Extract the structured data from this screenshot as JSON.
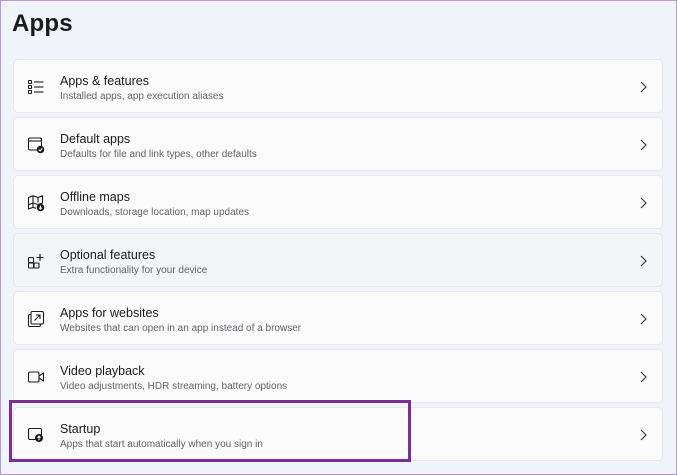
{
  "page": {
    "title": "Apps"
  },
  "items": [
    {
      "title": "Apps & features",
      "desc": "Installed apps, app execution aliases",
      "icon": "apps-list-icon"
    },
    {
      "title": "Default apps",
      "desc": "Defaults for file and link types, other defaults",
      "icon": "default-apps-icon"
    },
    {
      "title": "Offline maps",
      "desc": "Downloads, storage location, map updates",
      "icon": "map-icon"
    },
    {
      "title": "Optional features",
      "desc": "Extra functionality for your device",
      "icon": "optional-features-icon"
    },
    {
      "title": "Apps for websites",
      "desc": "Websites that can open in an app instead of a browser",
      "icon": "open-link-icon"
    },
    {
      "title": "Video playback",
      "desc": "Video adjustments, HDR streaming, battery options",
      "icon": "video-icon"
    },
    {
      "title": "Startup",
      "desc": "Apps that start automatically when you sign in",
      "icon": "startup-icon"
    }
  ],
  "colors": {
    "background": "#f0f3f9",
    "card": "#fbfbfc",
    "highlight_border": "#7a2e97"
  },
  "hovered_item": "Optional features",
  "highlighted_item": "Startup"
}
